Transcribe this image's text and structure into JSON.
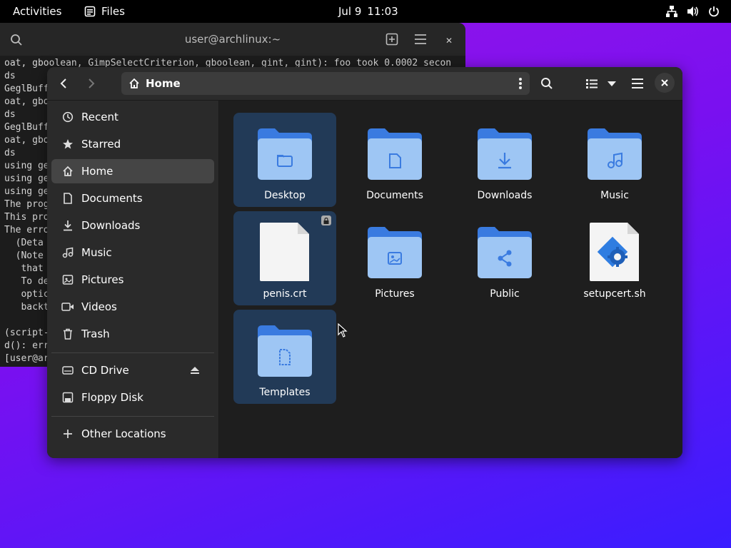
{
  "topbar": {
    "activities": "Activities",
    "app_name": "Files",
    "date": "Jul 9",
    "time": "11:03"
  },
  "terminal": {
    "title": "user@archlinux:~",
    "lines": [
      "oat, gboolean, GimpSelectCriterion, gboolean, gint, gint): foo took 0.0002 secon",
      "ds",
      "GeglBuff",
      "oat, gbo",
      "ds",
      "GeglBuff",
      "oat, gbo",
      "ds",
      "using ge",
      "using ge",
      "using ge",
      "The prog",
      "This pro",
      "The erro",
      "  (Deta",
      "  (Note",
      "   that",
      "   To de",
      "   optic",
      "   backt",
      "",
      "(script-",
      "d(): err",
      "[user@ar"
    ]
  },
  "files": {
    "path": "Home",
    "sidebar": {
      "places": [
        {
          "label": "Recent",
          "icon": "clock-icon",
          "active": false
        },
        {
          "label": "Starred",
          "icon": "star-icon",
          "active": false
        },
        {
          "label": "Home",
          "icon": "home-icon",
          "active": true
        },
        {
          "label": "Documents",
          "icon": "document-icon",
          "active": false
        },
        {
          "label": "Downloads",
          "icon": "download-icon",
          "active": false
        },
        {
          "label": "Music",
          "icon": "music-icon",
          "active": false
        },
        {
          "label": "Pictures",
          "icon": "picture-icon",
          "active": false
        },
        {
          "label": "Videos",
          "icon": "video-icon",
          "active": false
        },
        {
          "label": "Trash",
          "icon": "trash-icon",
          "active": false
        }
      ],
      "devices": [
        {
          "label": "CD Drive",
          "icon": "optical-drive-icon",
          "eject": true
        },
        {
          "label": "Floppy Disk",
          "icon": "floppy-icon",
          "eject": false
        }
      ],
      "other": "Other Locations"
    },
    "items": [
      {
        "name": "Desktop",
        "kind": "folder",
        "emblem": "folder",
        "selected": true
      },
      {
        "name": "Documents",
        "kind": "folder",
        "emblem": "document",
        "selected": false
      },
      {
        "name": "Downloads",
        "kind": "folder",
        "emblem": "download",
        "selected": false
      },
      {
        "name": "Music",
        "kind": "folder",
        "emblem": "music",
        "selected": false
      },
      {
        "name": "penis.crt",
        "kind": "file",
        "emblem": "",
        "selected": true,
        "locked": true
      },
      {
        "name": "Pictures",
        "kind": "folder",
        "emblem": "picture",
        "selected": false
      },
      {
        "name": "Public",
        "kind": "folder",
        "emblem": "share",
        "selected": false
      },
      {
        "name": "setupcert.sh",
        "kind": "script",
        "emblem": "gear",
        "selected": false
      },
      {
        "name": "Templates",
        "kind": "folder",
        "emblem": "template",
        "selected": true
      }
    ]
  },
  "colors": {
    "folder_back": "#3a7be0",
    "folder_front": "#9ec6f4",
    "selection": "#223a57",
    "accent": "#3584e4"
  }
}
